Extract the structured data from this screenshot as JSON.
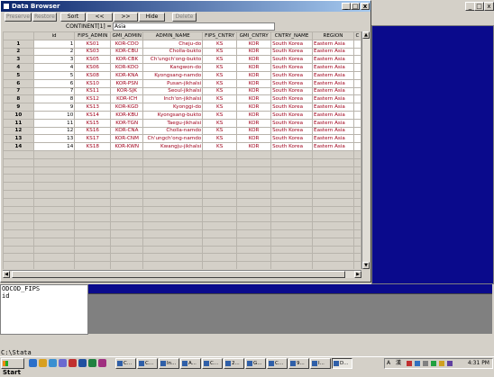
{
  "window": {
    "title": "Data Browser",
    "min": "_",
    "max": "□",
    "close": "x"
  },
  "background_window": {
    "min": "_",
    "max": "□",
    "close": "x"
  },
  "toolbar": {
    "preserve": "Preserve",
    "restore": "Restore",
    "sort": "Sort",
    "prev": "<<",
    "next": ">>",
    "hide": "Hide",
    "delete": "Delete"
  },
  "filter": {
    "label": "CONTINENT[1] =",
    "value": "Asia"
  },
  "columns": [
    "id",
    "FIPS_ADMIN",
    "GMI_ADMIN",
    "ADMIN_NAME",
    "FIPS_CNTRY",
    "GMI_CNTRY",
    "CNTRY_NAME",
    "REGION",
    "C"
  ],
  "rows": [
    {
      "rn": "1",
      "id": "1",
      "fips_admin": "KS01",
      "gmi_admin": "KOR-CDO",
      "admin_name": "Cheju-do",
      "fips_cntry": "KS",
      "gmi_cntry": "KOR",
      "cntry_name": "South Korea",
      "region": "Eastern Asia"
    },
    {
      "rn": "2",
      "id": "2",
      "fips_admin": "KS03",
      "gmi_admin": "KOR-CBU",
      "admin_name": "Cholla-bukto",
      "fips_cntry": "KS",
      "gmi_cntry": "KOR",
      "cntry_name": "South Korea",
      "region": "Eastern Asia"
    },
    {
      "rn": "3",
      "id": "3",
      "fips_admin": "KS05",
      "gmi_admin": "KOR-CBK",
      "admin_name": "Ch'ungch'ong-bukto",
      "fips_cntry": "KS",
      "gmi_cntry": "KOR",
      "cntry_name": "South Korea",
      "region": "Eastern Asia"
    },
    {
      "rn": "4",
      "id": "4",
      "fips_admin": "KS06",
      "gmi_admin": "KOR-KDO",
      "admin_name": "Kangwon-do",
      "fips_cntry": "KS",
      "gmi_cntry": "KOR",
      "cntry_name": "South Korea",
      "region": "Eastern Asia"
    },
    {
      "rn": "5",
      "id": "5",
      "fips_admin": "KS08",
      "gmi_admin": "KOR-KNA",
      "admin_name": "Kyongsang-namdo",
      "fips_cntry": "KS",
      "gmi_cntry": "KOR",
      "cntry_name": "South Korea",
      "region": "Eastern Asia"
    },
    {
      "rn": "6",
      "id": "6",
      "fips_admin": "KS10",
      "gmi_admin": "KOR-PSN",
      "admin_name": "Pusan-jikhalsi",
      "fips_cntry": "KS",
      "gmi_cntry": "KOR",
      "cntry_name": "South Korea",
      "region": "Eastern Asia"
    },
    {
      "rn": "7",
      "id": "7",
      "fips_admin": "KS11",
      "gmi_admin": "KOR-SJK",
      "admin_name": "Seoul-jikhalsi",
      "fips_cntry": "KS",
      "gmi_cntry": "KOR",
      "cntry_name": "South Korea",
      "region": "Eastern Asia"
    },
    {
      "rn": "8",
      "id": "8",
      "fips_admin": "KS12",
      "gmi_admin": "KOR-ICH",
      "admin_name": "Inch'on-jikhalsi",
      "fips_cntry": "KS",
      "gmi_cntry": "KOR",
      "cntry_name": "South Korea",
      "region": "Eastern Asia"
    },
    {
      "rn": "9",
      "id": "9",
      "fips_admin": "KS13",
      "gmi_admin": "KOR-KGD",
      "admin_name": "Kyonggi-do",
      "fips_cntry": "KS",
      "gmi_cntry": "KOR",
      "cntry_name": "South Korea",
      "region": "Eastern Asia"
    },
    {
      "rn": "10",
      "id": "10",
      "fips_admin": "KS14",
      "gmi_admin": "KOR-KBU",
      "admin_name": "Kyongsang-bukto",
      "fips_cntry": "KS",
      "gmi_cntry": "KOR",
      "cntry_name": "South Korea",
      "region": "Eastern Asia"
    },
    {
      "rn": "11",
      "id": "11",
      "fips_admin": "KS15",
      "gmi_admin": "KOR-TGN",
      "admin_name": "Taegu-jikhalsi",
      "fips_cntry": "KS",
      "gmi_cntry": "KOR",
      "cntry_name": "South Korea",
      "region": "Eastern Asia"
    },
    {
      "rn": "12",
      "id": "12",
      "fips_admin": "KS16",
      "gmi_admin": "KOR-CNA",
      "admin_name": "Cholla-namdo",
      "fips_cntry": "KS",
      "gmi_cntry": "KOR",
      "cntry_name": "South Korea",
      "region": "Eastern Asia"
    },
    {
      "rn": "13",
      "id": "13",
      "fips_admin": "KS17",
      "gmi_admin": "KOR-CNM",
      "admin_name": "Ch'ungch'ong-namdo",
      "fips_cntry": "KS",
      "gmi_cntry": "KOR",
      "cntry_name": "South Korea",
      "region": "Eastern Asia"
    },
    {
      "rn": "14",
      "id": "14",
      "fips_admin": "KS18",
      "gmi_admin": "KOR-KWN",
      "admin_name": "Kwangju-jikhalsi",
      "fips_cntry": "KS",
      "gmi_cntry": "KOR",
      "cntry_name": "South Korea",
      "region": "Eastern Asia"
    }
  ],
  "var_panel": {
    "lines": [
      "ODCOD_FIPS",
      "id"
    ]
  },
  "command_line": "C:\\Stata",
  "taskbar": {
    "start": "Start",
    "tasks": [
      "C...",
      "C...",
      "In...",
      "A...",
      "C...",
      "2...",
      "G...",
      "C...",
      "9...",
      "I...",
      "D..."
    ],
    "active_task_index": 10,
    "tray_lang": "A",
    "tray_ime": "漢",
    "clock": "4:31 PM"
  },
  "colors": {
    "title_active": "#0a246a",
    "string_cells": "#a0001a",
    "background_panel": "#0a0a8c",
    "face": "#d4d0c8"
  }
}
